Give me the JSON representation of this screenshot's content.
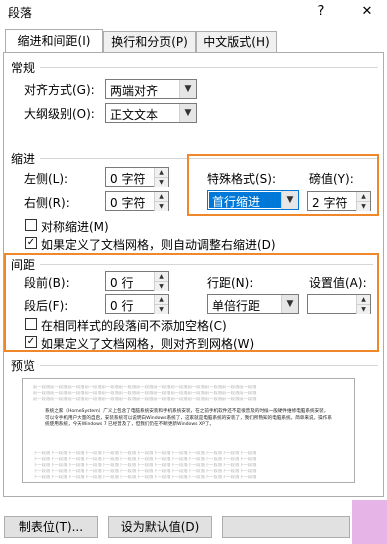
{
  "window": {
    "title": "段落",
    "help_glyph": "?",
    "close_glyph": "✕"
  },
  "tabs": [
    {
      "label": "缩进和间距(I)"
    },
    {
      "label": "换行和分页(P)"
    },
    {
      "label": "中文版式(H)"
    }
  ],
  "general": {
    "heading": "常规",
    "alignment_label": "对齐方式(G):",
    "alignment_value": "两端对齐",
    "outline_label": "大纲级别(O):",
    "outline_value": "正文文本"
  },
  "indent": {
    "heading": "缩进",
    "left_label": "左侧(L):",
    "left_value": "0 字符",
    "right_label": "右侧(R):",
    "right_value": "0 字符",
    "special_label": "特殊格式(S):",
    "special_value": "首行缩进",
    "by_label": "磅值(Y):",
    "by_value": "2 字符",
    "mirror_label": "对称缩进(M)",
    "mirror_checked": false,
    "auto_adjust_label": "如果定义了文档网格，则自动调整右缩进(D)",
    "auto_adjust_checked": true
  },
  "spacing": {
    "heading": "间距",
    "before_label": "段前(B):",
    "before_value": "0 行",
    "after_label": "段后(F):",
    "after_value": "0 行",
    "line_label": "行距(N):",
    "line_value": "单倍行距",
    "at_label": "设置值(A):",
    "at_value": "",
    "no_space_label": "在相同样式的段落间不添加空格(C)",
    "no_space_checked": false,
    "snap_grid_label": "如果定义了文档网格，则对齐到网格(W)",
    "snap_grid_checked": true
  },
  "preview": {
    "heading": "预览",
    "filler_line": "前一段落前一段落前一段落前一段落前一段落前一段落前一段落前一段落前一段落前一段落前一段落前一段落前一段落",
    "sample_text": "系统之家（HomeSystem）广义上包含了电脑系统安装和手机系统安装，在之前手机软件还不是很普及的时候一般硬件维修电脑系统安装，可以令手机用户大量的自启，安装系统可以说明白Windows系统了，这家就是电脑系统的安装了，我们所熟知的电脑系统，简单来说，操作系统使用系统，今天Windows 7 已经普及了，但我们仍在不断更新Windows XP了。",
    "after_line": "下一段落下一段落下一段落下一段落下一段落下一段落下一段落下一段落下一段落下一段落下一段落下一段落下一段落"
  },
  "buttons": {
    "tabs_label": "制表位(T)...",
    "default_label": "设为默认值(D)"
  },
  "colors": {
    "highlight": "#f0872b",
    "selection": "#0078d7"
  }
}
